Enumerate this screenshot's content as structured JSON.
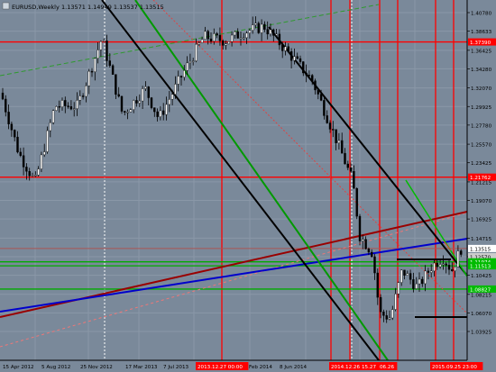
{
  "header": {
    "symbol": "EURUSD,Weekly",
    "ohlc": "1.13571 1.14949 1.13537 1.13515"
  },
  "price_labels": [
    "1.40780",
    "1.38633",
    "1.36425",
    "1.34280",
    "1.32070",
    "1.29925",
    "1.27780",
    "1.25570",
    "1.23425",
    "1.21215",
    "1.19070",
    "1.16925",
    "1.14715",
    "1.12570",
    "1.10425",
    "1.08215",
    "1.06070",
    "1.03925"
  ],
  "highlighted_labels": [
    {
      "text": "1.37390",
      "price": 1.3739,
      "color": "#ff0000",
      "text_color": "#ffffff"
    },
    {
      "text": "1.21762",
      "price": 1.21762,
      "color": "#ff0000",
      "text_color": "#ffffff"
    },
    {
      "text": "1.13515",
      "price": 1.13515,
      "color": "#ffffff",
      "text_color": "#000000"
    },
    {
      "text": "1.12570",
      "price": 1.1257,
      "color": "#cccccc",
      "text_color": "#000000"
    },
    {
      "text": "1.11974",
      "price": 1.11974,
      "color": "#00bb00",
      "text_color": "#ffffff"
    },
    {
      "text": "1.11513",
      "price": 1.11513,
      "color": "#00bb00",
      "text_color": "#ffffff"
    },
    {
      "text": "1.08827",
      "price": 1.08827,
      "color": "#00bb00",
      "text_color": "#ffffff"
    }
  ],
  "time_labels": [
    {
      "text": "15 Apr 2012",
      "highlight": false
    },
    {
      "text": "5 Aug 2012",
      "highlight": false
    },
    {
      "text": "25 Nov 2012",
      "highlight": false
    },
    {
      "text": "17 Mar 2013",
      "highlight": false
    },
    {
      "text": "7 Jul 2013",
      "highlight": false
    },
    {
      "text": "2013.12.27 00:00",
      "highlight": true
    },
    {
      "text": "Feb 2014",
      "highlight": false
    },
    {
      "text": "8 Jun 2014",
      "highlight": false
    },
    {
      "text": "2014.12.26 00:00",
      "highlight": true
    },
    {
      "text": "15.27 00:00",
      "highlight": true
    },
    {
      "text": "06.26",
      "highlight": true
    },
    {
      "text": "2015.09.25 23:00",
      "highlight": true
    }
  ],
  "colors": {
    "background": "#7a899a",
    "bull_candle": "#ffffff",
    "bear_candle": "#000000",
    "grid": "#8a98a8",
    "red_line": "#ff0000",
    "green_line": "#00aa00",
    "blue_line": "#0000cc",
    "dark_red_line": "#990000",
    "black_line": "#000000"
  }
}
